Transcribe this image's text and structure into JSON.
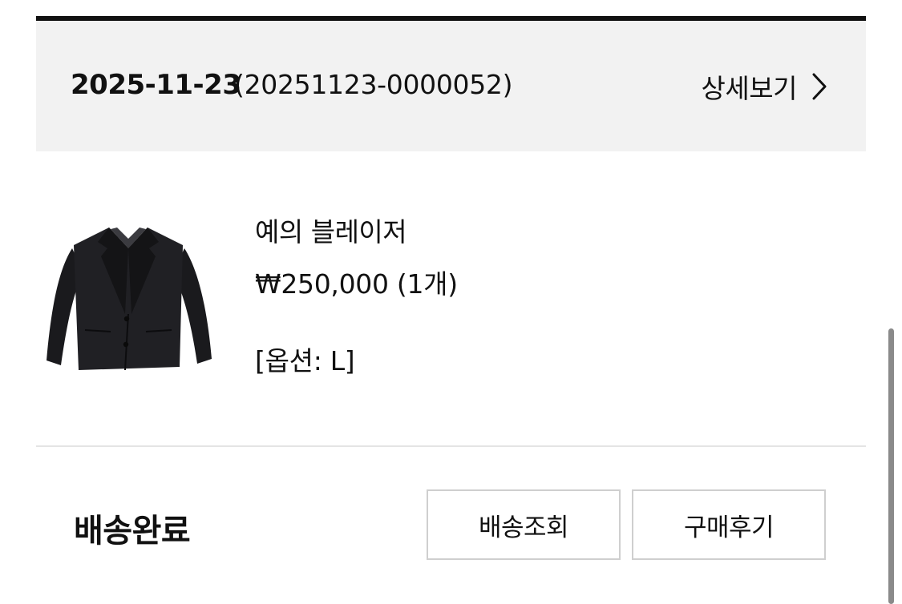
{
  "order": {
    "date": "2025-11-23",
    "number": "(20251123-0000052)",
    "detail_label": "상세보기"
  },
  "product": {
    "name": "예의 블레이저",
    "price": "₩250,000 (1개)",
    "option": "[옵션: L]",
    "image_icon": "blazer-image"
  },
  "delivery": {
    "status": "배송완료",
    "track_button": "배송조회",
    "review_button": "구매후기"
  },
  "icons": {
    "detail_chevron": "chevron-right-icon"
  },
  "colors": {
    "header_bg": "#f2f2f2",
    "top_rule": "#111111",
    "button_border": "#cfcfcf",
    "divider": "#e4e4e4"
  }
}
